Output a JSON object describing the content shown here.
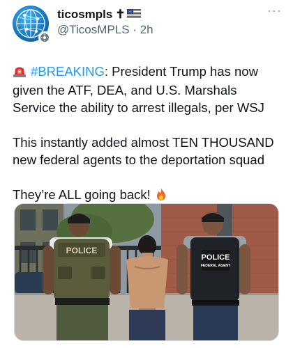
{
  "author": {
    "display_name": "ticosmpls",
    "name_suffix": "✝",
    "handle": "@TicosMPLS",
    "separator": "·",
    "time": "2h"
  },
  "menu": {
    "more_label": "···"
  },
  "tweet": {
    "line1_hashtag": "#BREAKING",
    "line1_rest": ": President Trump has now given the ATF, DEA, and U.S. Marshals Service the ability to arrest illegals, per WSJ",
    "para2": "This instantly added almost TEN THOUSAND new federal agents to the deportation squad",
    "para3": "They’re ALL going back!"
  },
  "media": {
    "vest_left_text": "POLICE",
    "vest_right_text": "POLICE",
    "vest_right_subtext": "FEDERAL AGENT"
  },
  "colors": {
    "hashtag": "#1d9bf0",
    "text": "#0f1419",
    "secondary": "#536471"
  },
  "icons": {
    "siren": "rotating-light-emoji",
    "fire": "fire-emoji",
    "flag": "us-flag-emoji",
    "more": "more-horizontal-icon"
  }
}
